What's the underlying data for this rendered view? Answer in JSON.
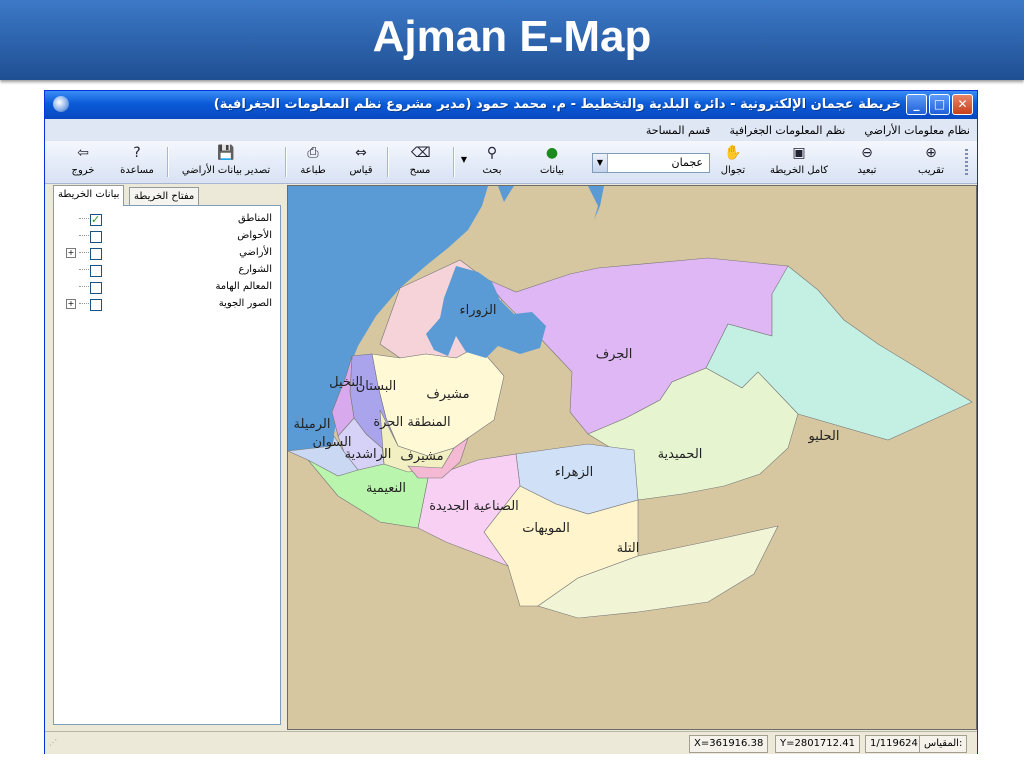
{
  "slide": {
    "title": "Ajman E-Map"
  },
  "window": {
    "title": "خريطة عجمان الإلكترونية - دائرة البلدية والتخطيط  -  م. محمد حمود (مدير مشروع نظم المعلومات الجغرافية)",
    "controls": {
      "minimize": "_",
      "maximize": "□",
      "close": "✕"
    }
  },
  "menu": {
    "items": [
      "نظام معلومات الأراضي",
      "نظم المعلومات الجغرافية",
      "قسم المساحة"
    ]
  },
  "toolbar": {
    "zoom_in": "تقريب",
    "zoom_out": "تبعيد",
    "full_map": "كامل الخريطة",
    "pan": "تجوال",
    "emirate_value": "عجمان",
    "info": "بيانات",
    "search": "بحث",
    "clear": "مسح",
    "measure": "قياس",
    "print": "طباعة",
    "export": "تصدير بيانات الأراضي",
    "help": "مساعدة",
    "exit": "خروج"
  },
  "tabs": {
    "map_data": "بيانات الخريطة",
    "map_key": "مفتاح الخريطة"
  },
  "layers": [
    {
      "label": "المناطق",
      "checked": true
    },
    {
      "label": "الأحواض",
      "checked": false
    },
    {
      "label": "الأراضي",
      "checked": false,
      "expandable": true
    },
    {
      "label": "الشوارع",
      "checked": false
    },
    {
      "label": "المعالم الهامة",
      "checked": false
    },
    {
      "label": "الصور الجوية",
      "checked": false,
      "expandable": true
    }
  ],
  "map": {
    "colors": {
      "sea": "#5b9bd5",
      "land": "#d6c7a1"
    },
    "regions": {
      "zorah": "الزوراء",
      "jurf": "الجرف",
      "helio": "الحليو",
      "nakhil": "النخيل",
      "bustan": "البستان",
      "mushairef": "مشيرف",
      "free_zone": "المنطقة الحرة",
      "rumailah": "الرميلة",
      "sawan": "السوان",
      "rashidiya": "الراشدية",
      "mushairef2": "مشيرف",
      "hamidiya": "الحميدية",
      "zahra": "الزهراء",
      "nuaimiya": "النعيمية",
      "new_industrial": "الصناعية الجديدة",
      "mowaihat": "المويهات",
      "tallah": "التلة"
    }
  },
  "status": {
    "x": "X=361916.38",
    "y": "Y=2801712.41",
    "scale_value": "1/119624",
    "scale_label": "المقياس:"
  }
}
